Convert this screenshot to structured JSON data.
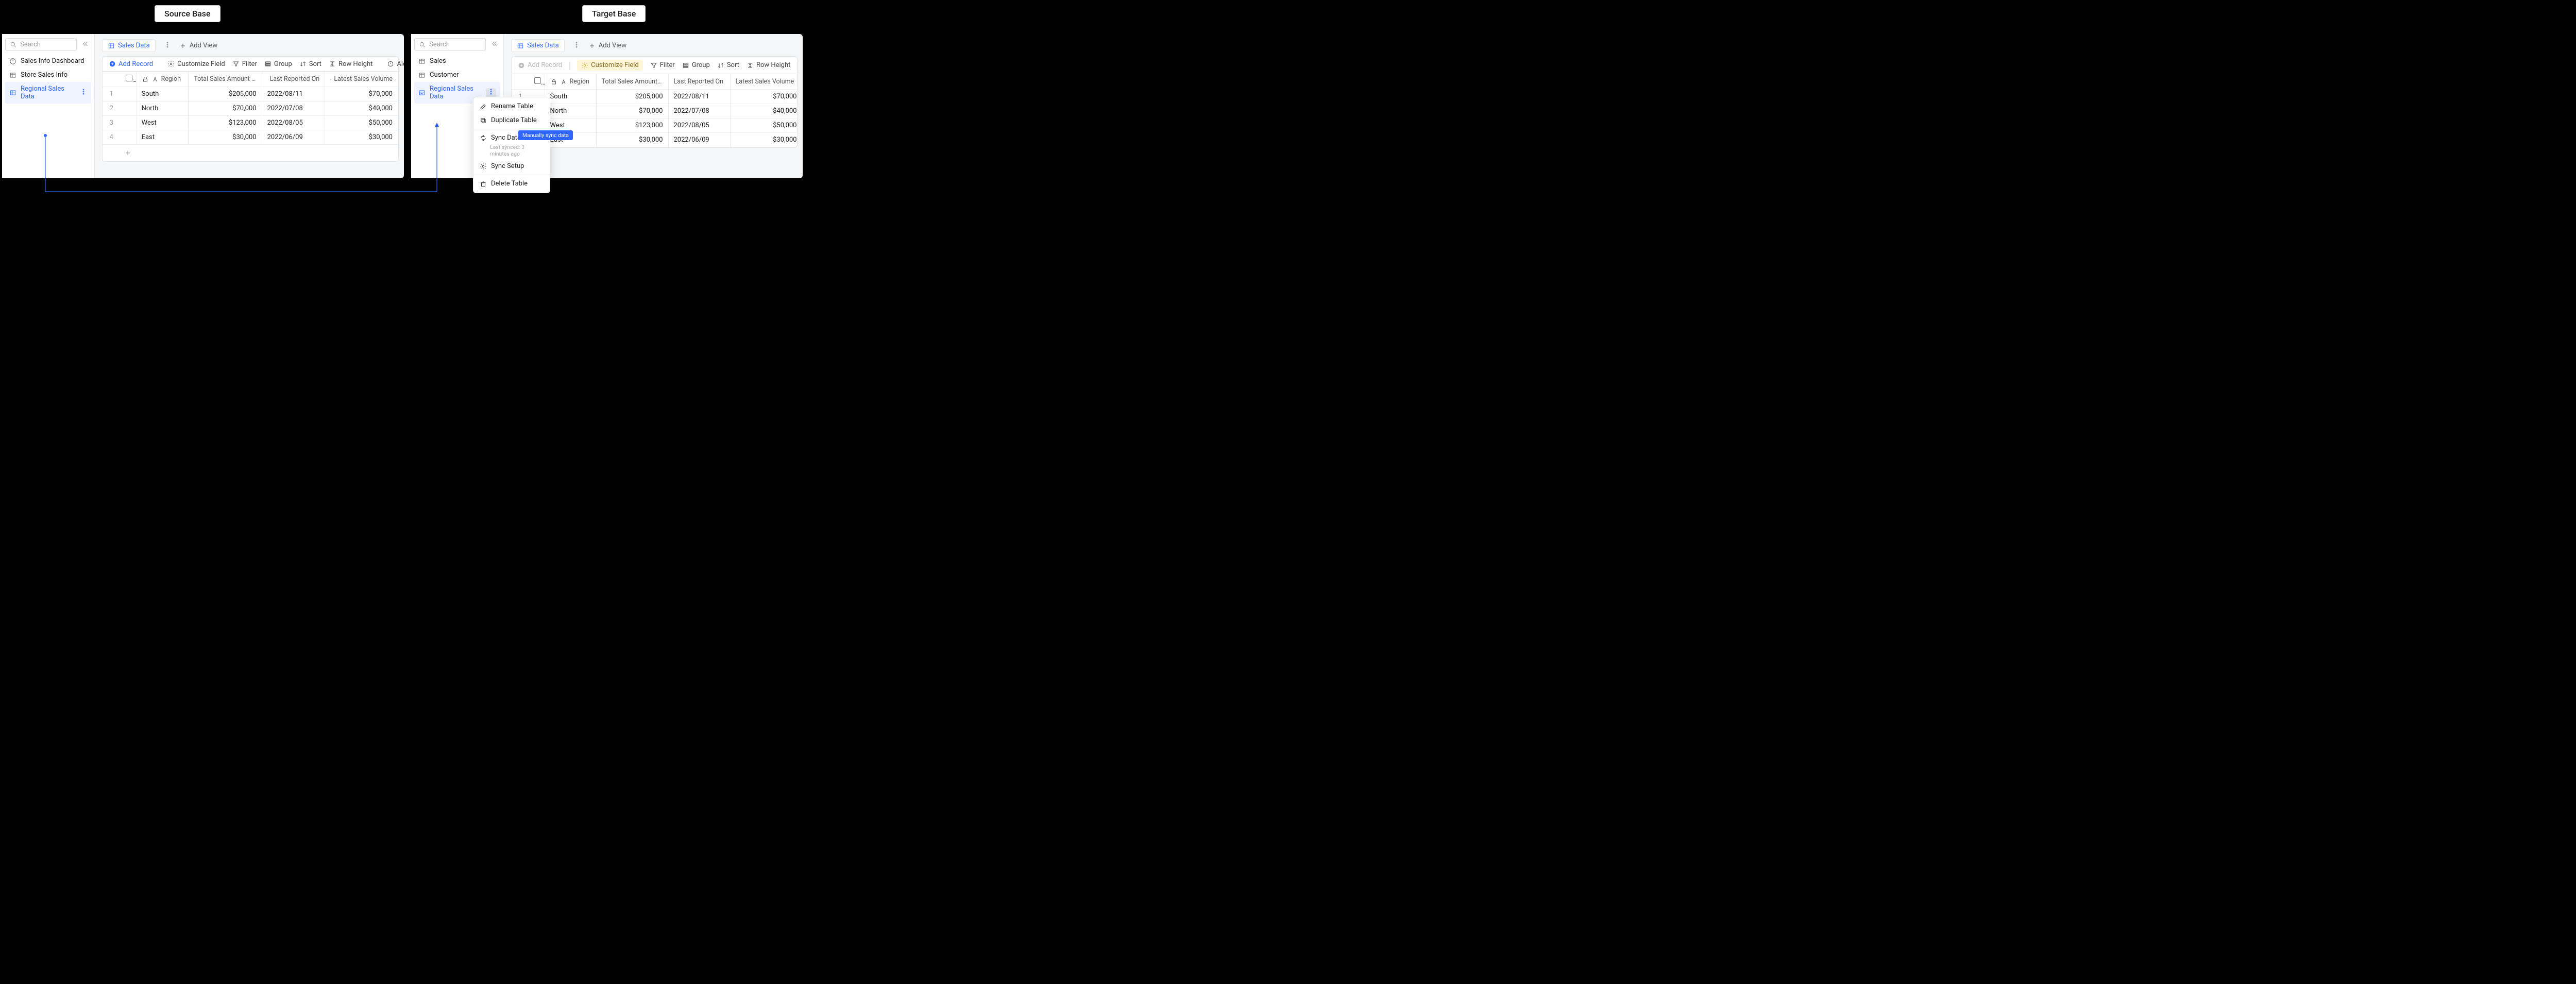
{
  "labels": {
    "source": "Source Base",
    "target": "Target Base"
  },
  "source": {
    "search_placeholder": "Search",
    "nav": [
      {
        "label": "Sales Info Dashboard",
        "icon": "dashboard"
      },
      {
        "label": "Store Sales Info",
        "icon": "table"
      },
      {
        "label": "Regional Sales Data",
        "icon": "table",
        "active": true
      }
    ],
    "tab": "Sales Data",
    "add_view": "Add View",
    "toolbar": {
      "add_record": "Add Record",
      "customize_field": "Customize Field",
      "filter": "Filter",
      "group": "Group",
      "sort": "Sort",
      "row_height": "Row Height",
      "alert": "Alert"
    },
    "columns": [
      "Region",
      "Total Sales Amount by...",
      "Last Reported On",
      "Latest Sales Volume"
    ],
    "rows": [
      {
        "idx": "1",
        "region": "South",
        "total": "$205,000",
        "date": "2022/08/11",
        "vol": "$70,000"
      },
      {
        "idx": "2",
        "region": "North",
        "total": "$70,000",
        "date": "2022/07/08",
        "vol": "$40,000"
      },
      {
        "idx": "3",
        "region": "West",
        "total": "$123,000",
        "date": "2022/08/05",
        "vol": "$50,000"
      },
      {
        "idx": "4",
        "region": "East",
        "total": "$30,000",
        "date": "2022/06/09",
        "vol": "$30,000"
      }
    ]
  },
  "target": {
    "search_placeholder": "Search",
    "nav": [
      {
        "label": "Sales",
        "icon": "table"
      },
      {
        "label": "Customer",
        "icon": "table"
      },
      {
        "label": "Regional Sales Data",
        "icon": "sync-table",
        "active": true,
        "menu_open": true
      }
    ],
    "tab": "Sales Data",
    "add_view": "Add View",
    "toolbar": {
      "add_record": "Add Record",
      "customize_field": "Customize Field",
      "filter": "Filter",
      "group": "Group",
      "sort": "Sort",
      "row_height": "Row Height"
    },
    "columns": [
      "Region",
      "Total Sales Amount by...",
      "Last Reported On",
      "Latest Sales Volume"
    ],
    "rows": [
      {
        "idx": "1",
        "region": "South",
        "total": "$205,000",
        "date": "2022/08/11",
        "vol": "$70,000"
      },
      {
        "idx": "",
        "region": "North",
        "total": "$70,000",
        "date": "2022/07/08",
        "vol": "$40,000"
      },
      {
        "idx": "",
        "region": "West",
        "total": "$123,000",
        "date": "2022/08/05",
        "vol": "$50,000"
      },
      {
        "idx": "",
        "region": "East",
        "total": "$30,000",
        "date": "2022/06/09",
        "vol": "$30,000"
      }
    ],
    "context_menu": {
      "rename": "Rename Table",
      "duplicate": "Duplicate Table",
      "sync_data": "Sync Data",
      "sync_sub": "Last synced: 3 minutes ago",
      "sync_setup": "Sync Setup",
      "delete": "Delete Table",
      "tooltip": "Manually sync data"
    }
  }
}
